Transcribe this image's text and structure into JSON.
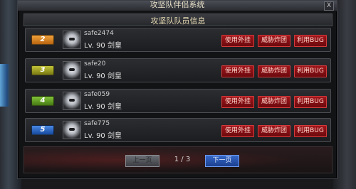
{
  "window": {
    "title": "攻坚队伴侣系统",
    "close_label": "X"
  },
  "subheader": "攻坚队队员信息",
  "colors": {
    "rank_orange": "#d9821e",
    "rank_olive": "#9a9a22",
    "rank_green": "#5e9a1e",
    "rank_blue": "#1f5fb8",
    "action_red": "#8b1014",
    "next_blue": "#2a56b0"
  },
  "actions": {
    "use_cheat": "使用外挂",
    "threaten": "威胁炸团",
    "exploit_bug": "利用BUG"
  },
  "members": [
    {
      "rank": "2",
      "name": "safe2474",
      "level": "Lv. 90",
      "class": "剑皇",
      "color": "#d9821e"
    },
    {
      "rank": "3",
      "name": "safe20",
      "level": "Lv. 90",
      "class": "剑皇",
      "color": "#9a9a22"
    },
    {
      "rank": "4",
      "name": "safe059",
      "level": "Lv. 90",
      "class": "剑皇",
      "color": "#5e9a1e"
    },
    {
      "rank": "5",
      "name": "safe775",
      "level": "Lv. 90",
      "class": "剑皇",
      "color": "#1f5fb8"
    }
  ],
  "pager": {
    "prev": "上一页",
    "indicator": "1 / 3",
    "next": "下一页"
  }
}
